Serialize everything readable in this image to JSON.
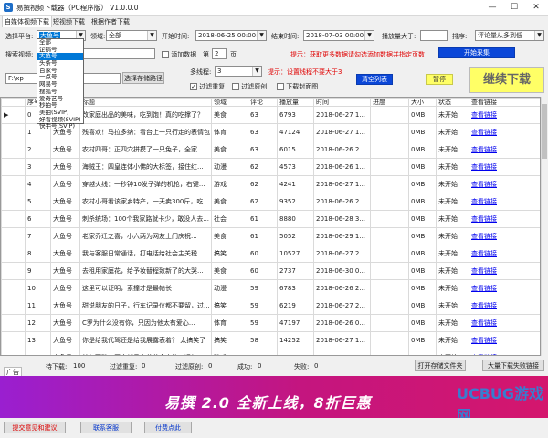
{
  "window": {
    "title": "易撰视频下载器（PC程序版） V1.0.0.0",
    "min": "—",
    "max": "☐",
    "close": "✕"
  },
  "menu": [
    "自媒体视频下载",
    "短视频下载",
    "根据作者下载"
  ],
  "filters": {
    "platform_label": "选择平台:",
    "platform_value": "大鱼号",
    "domain_label": "领域:",
    "domain_value": "全部",
    "start_label": "开始时间:",
    "start_value": "2018-06-25 00:00:00",
    "end_label": "结束时间:",
    "end_value": "2018-07-03 00:00:00",
    "plays_label": "播放量大于:",
    "plays_value": "",
    "sort_label": "排序:",
    "sort_value": "评论量从多到低",
    "search_label": "搜索视频:",
    "search_value": "",
    "add_data_label": "添加数据",
    "page_label": "第",
    "page_value": "2",
    "page_unit": "页",
    "red_tip": "提示：获取更多数据请勾选添加数据并指定页数",
    "start_collect": "开始采集"
  },
  "platform_options": [
    "全部",
    "企鹅号",
    "大鱼号",
    "头条号",
    "百家号",
    "一点号",
    "网易号",
    "搜狐号",
    "爱奇艺号",
    "秒拍号",
    "美拍(SVIP)",
    "好看视频(SVIP)",
    "快手号(SVIP)"
  ],
  "download": {
    "path_value": "F:\\xp",
    "choose_path": "选择存储路径",
    "threads_label": "多线程:",
    "threads_value": "3",
    "threads_tip": "提示：设置线程不要大于3",
    "filter_dup": "过滤重复",
    "filter_orig": "过滤原创",
    "download_cover": "下载封面图",
    "clear_list": "清空列表",
    "pause": "暂停",
    "resume": "继续下载"
  },
  "table": {
    "columns": [
      "",
      "序号",
      "作者",
      "标题",
      "领域",
      "评论",
      "播放量",
      "时间",
      "进度",
      "大小",
      "状态",
      "查看链接"
    ],
    "rows": [
      [
        "▶",
        "0",
        "大鱼号",
        "改家庭出品的美味，吃到饱！真的吃撑了？",
        "美食",
        "63",
        "6793",
        "2018-06-27 1...",
        "",
        "0MB",
        "未开始",
        "查看链接"
      ],
      [
        "",
        "1",
        "大鱼号",
        "残喜欢！马拉多纳：看台上一只行走的表情包",
        "体育",
        "63",
        "47124",
        "2018-06-27 1...",
        "",
        "0MB",
        "未开始",
        "查看链接"
      ],
      [
        "",
        "2",
        "大鱼号",
        "农村四哥：正四穴拼摸了一只兔子，全家...",
        "美食",
        "63",
        "6015",
        "2018-06-26 2...",
        "",
        "0MB",
        "未开始",
        "查看链接"
      ],
      [
        "",
        "3",
        "大鱼号",
        "海贼王：四皇连体小佛的大标签，接住红...",
        "动漫",
        "62",
        "4573",
        "2018-06-26 1...",
        "",
        "0MB",
        "未开始",
        "查看链接"
      ],
      [
        "",
        "4",
        "大鱼号",
        "穿越火线：一秒钟10发子弹的机枪，右键...",
        "游戏",
        "62",
        "4241",
        "2018-06-27 1...",
        "",
        "0MB",
        "未开始",
        "查看链接"
      ],
      [
        "",
        "5",
        "大鱼号",
        "农村小哥看该家乡特产，一天卖300斤，吃...",
        "美食",
        "62",
        "9352",
        "2018-06-26 2...",
        "",
        "0MB",
        "未开始",
        "查看链接"
      ],
      [
        "",
        "6",
        "大鱼号",
        "刺杀统场：100个我家路就卡少，敢没人去...",
        "社会",
        "61",
        "8880",
        "2018-06-28 3...",
        "",
        "0MB",
        "未开始",
        "查看链接"
      ],
      [
        "",
        "7",
        "大鱼号",
        "老家乔迁之喜，小六两为网友上门庆祝...",
        "美食",
        "61",
        "5052",
        "2018-06-29 1...",
        "",
        "0MB",
        "未开始",
        "查看链接"
      ],
      [
        "",
        "8",
        "大鱼号",
        "我与客服日常通话，打电话给社会主关税...",
        "搞笑",
        "60",
        "10527",
        "2018-06-27 2...",
        "",
        "0MB",
        "未开始",
        "查看链接"
      ],
      [
        "",
        "9",
        "大鱼号",
        "去租用家庭花，给予妆替程致新了的大哭...",
        "美食",
        "60",
        "2737",
        "2018-06-30 0...",
        "",
        "0MB",
        "未开始",
        "查看链接"
      ],
      [
        "",
        "10",
        "大鱼号",
        "这里可以证明，索撞才是最帕长",
        "动漫",
        "59",
        "6783",
        "2018-06-26 2...",
        "",
        "0MB",
        "未开始",
        "查看链接"
      ],
      [
        "",
        "11",
        "大鱼号",
        "甜说朋友的日子，行车记录仪都不要留，过...",
        "搞笑",
        "59",
        "6219",
        "2018-06-27 2...",
        "",
        "0MB",
        "未开始",
        "查看链接"
      ],
      [
        "",
        "12",
        "大鱼号",
        "C罗为什么没有你，只因为他太有爱心...",
        "体育",
        "59",
        "47197",
        "2018-06-26 0...",
        "",
        "0MB",
        "未开始",
        "查看链接"
      ],
      [
        "",
        "13",
        "大鱼号",
        "你是给我代驾还是给我展露表着？ 太搞笑了",
        "搞笑",
        "58",
        "14252",
        "2018-06-27 1...",
        "",
        "0MB",
        "未开始",
        "查看链接"
      ],
      [
        "",
        "14",
        "大鱼号",
        "梦幻西游：买个新号来养养金宝箱，运气...",
        "游戏",
        "57",
        "2274",
        "2018-06-26 1...",
        "",
        "0MB",
        "未开始",
        "查看链接"
      ],
      [
        "",
        "15",
        "大鱼号",
        "名四时艺宋藏不致 为晨晨乘一份小龙虾晨...",
        "美食",
        "56",
        "2061",
        "2018-06-26 0...",
        "",
        "0MB",
        "未开始",
        "查看链接"
      ],
      [
        "",
        "16",
        "大鱼号",
        "海贼王两分钟带你看完索隆两年后的霸气...",
        "动漫",
        "56",
        "3740",
        "2018-06-26 2...",
        "",
        "0MB",
        "未开始",
        "查看链接"
      ],
      [
        "",
        "17",
        "大鱼号",
        "小型网两月工厂、阳阳仕一大早就过来来...",
        "旅游",
        "57",
        "7626",
        "2018-06-26 1...",
        "",
        "0MB",
        "未开始",
        "查看链接"
      ]
    ]
  },
  "status": {
    "ad_label": "广告",
    "pending_label": "待下载:",
    "pending_value": "100",
    "dup_label": "过滤重复:",
    "dup_value": "0",
    "orig_label": "过滤原创:",
    "orig_value": "0",
    "success_label": "成功:",
    "success_value": "0",
    "fail_label": "失败:",
    "fail_value": "0",
    "open_folder": "打开存储文件夹",
    "batch_export": "大量下载失败链接"
  },
  "banner": {
    "text": "易撰 2.0 全新上线，8折巨惠",
    "watermark": "UCBUG游戏网"
  },
  "bottom": {
    "feedback": "提交意见和建议",
    "contact": "联系客服",
    "pay": "付费点此"
  },
  "colors": {
    "brand_blue": "#0b47d8",
    "banner_start": "#9a1fd0",
    "banner_end": "#d4166d",
    "accent_red": "#e00000",
    "highlight_yellow": "#ffff66"
  }
}
